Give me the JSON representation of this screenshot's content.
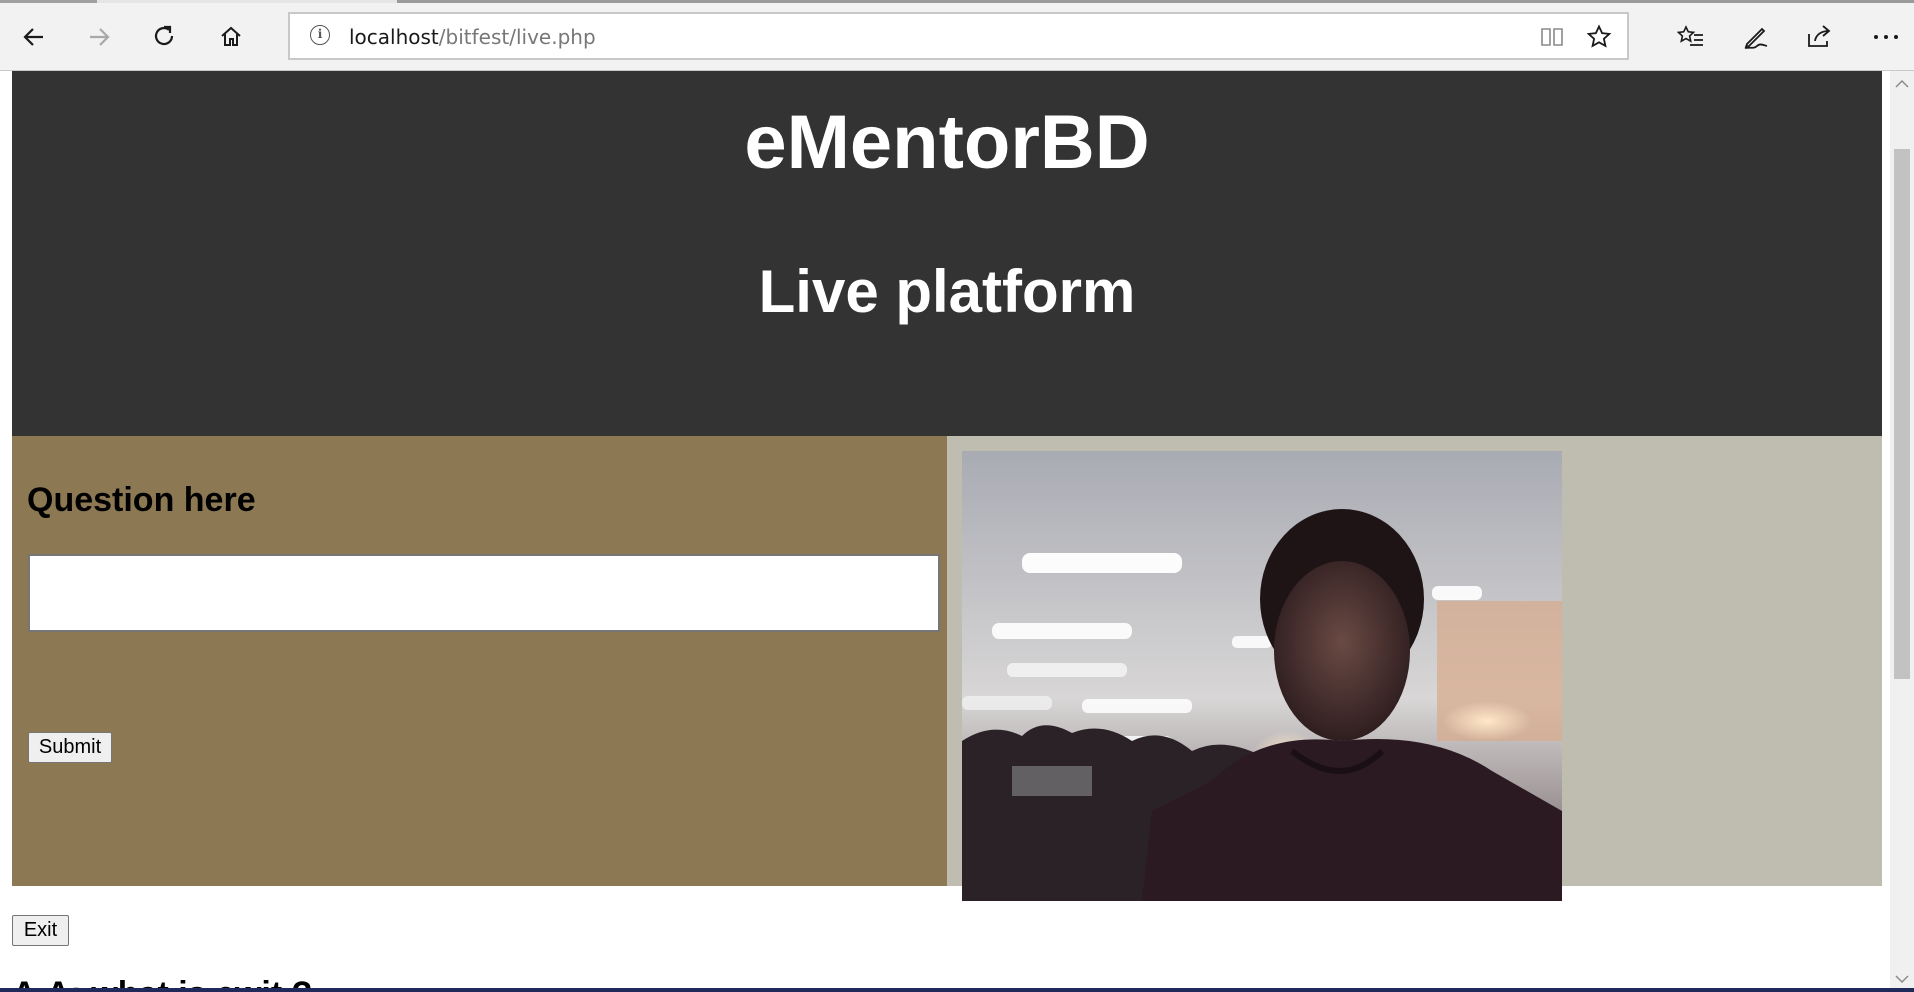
{
  "browser": {
    "url_host": "localhost",
    "url_path": "/bitfest/live.php",
    "icons": {
      "back": "back-arrow-icon",
      "forward": "forward-arrow-icon",
      "refresh": "refresh-icon",
      "home": "home-icon",
      "info": "info-icon",
      "reading_view": "reading-view-icon",
      "favorite": "star-icon",
      "favorites_hub": "favorites-list-icon",
      "notes": "pen-icon",
      "share": "share-icon",
      "more": "more-dots-icon"
    }
  },
  "header": {
    "title": "eMentorBD",
    "subtitle": "Live platform",
    "background": "#333333"
  },
  "question": {
    "heading": "Question here",
    "input_value": "",
    "submit_label": "Submit",
    "background": "#8c7853"
  },
  "video": {
    "background": "#bfbcb0",
    "content": "webcam-feed"
  },
  "exit_label": "Exit",
  "answer_heading": "A.A: what is ewit ?"
}
